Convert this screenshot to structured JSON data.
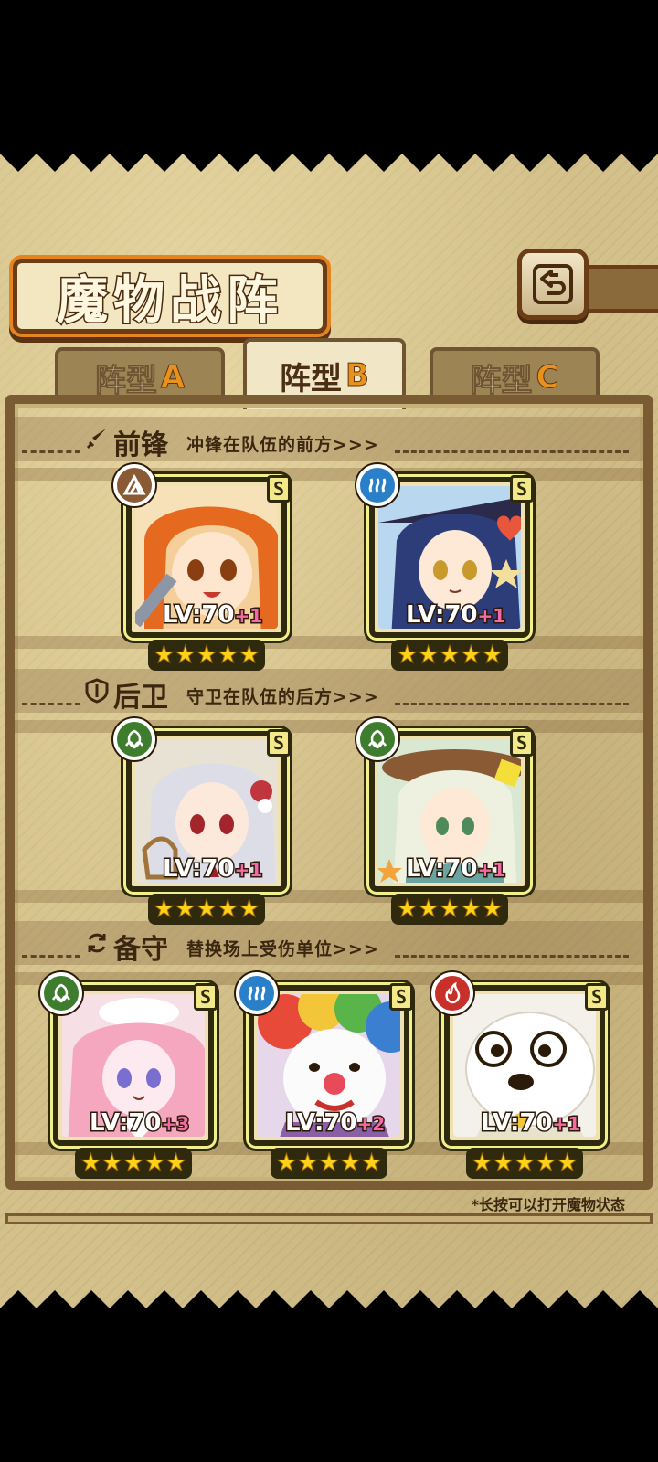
{
  "header": {
    "title": "魔物战阵",
    "back_icon": "return-arrow-icon"
  },
  "tabs": [
    {
      "name": "阵型",
      "letter": "A",
      "active": false
    },
    {
      "name": "阵型",
      "letter": "B",
      "active": true
    },
    {
      "name": "阵型",
      "letter": "C",
      "active": false
    }
  ],
  "sections": {
    "front": {
      "icon": "sword-icon",
      "title": "前锋",
      "desc": "冲锋在队伍的前方>>>"
    },
    "back": {
      "icon": "shield-icon",
      "title": "后卫",
      "desc": "守卫在队伍的后方>>>"
    },
    "reserve": {
      "icon": "swap-icon",
      "title": "备守",
      "desc": "替换场上受伤单位>>>"
    }
  },
  "cards": [
    {
      "section": "front",
      "rank": "S",
      "element": "rock",
      "element_color": "#8a5a34",
      "level": "LV:70",
      "plus": "+1",
      "stars": 5
    },
    {
      "section": "front",
      "rank": "S",
      "element": "water",
      "element_color": "#2a7fc9",
      "level": "LV:70",
      "plus": "+1",
      "stars": 5
    },
    {
      "section": "back",
      "rank": "S",
      "element": "leaf",
      "element_color": "#3e7d2e",
      "level": "LV:70",
      "plus": "+1",
      "stars": 5
    },
    {
      "section": "back",
      "rank": "S",
      "element": "leaf",
      "element_color": "#3e7d2e",
      "level": "LV:70",
      "plus": "+1",
      "stars": 5
    },
    {
      "section": "reserve",
      "rank": "S",
      "element": "leaf",
      "element_color": "#3e7d2e",
      "level": "LV:70",
      "plus": "+3",
      "stars": 5
    },
    {
      "section": "reserve",
      "rank": "S",
      "element": "water",
      "element_color": "#2a7fc9",
      "level": "LV:70",
      "plus": "+2",
      "stars": 5
    },
    {
      "section": "reserve",
      "rank": "S",
      "element": "fire",
      "element_color": "#c8302a",
      "level": "LV:70",
      "plus": "+1",
      "stars": 5
    }
  ],
  "footnote": "*长按可以打开魔物状态",
  "colors": {
    "accent_orange": "#e8911c",
    "frame_brown": "#6a3d16",
    "plus_pink": "#f36aa6",
    "star_yellow": "#ffd21a"
  }
}
